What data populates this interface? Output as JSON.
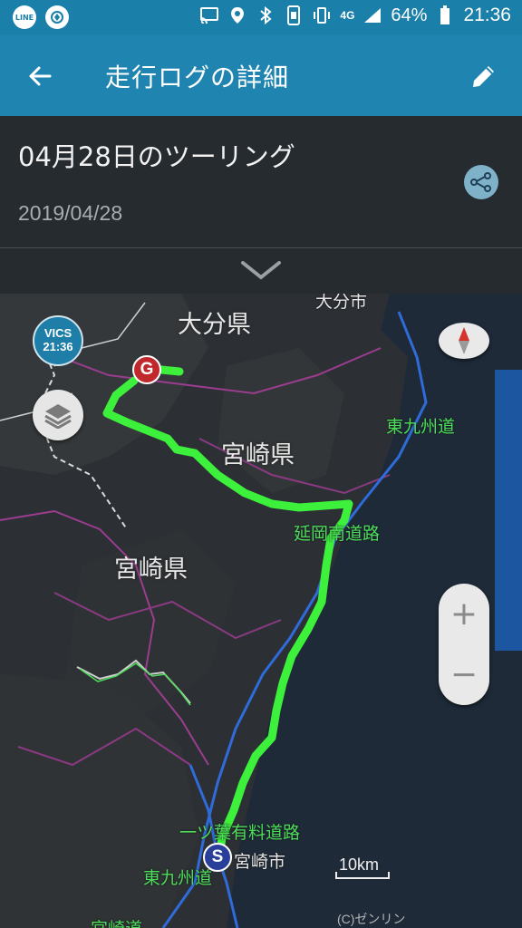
{
  "status_bar": {
    "apps": [
      "LINE",
      "app-circle"
    ],
    "network": "4G",
    "battery_percent": "64%",
    "time": "21:36",
    "icons": [
      "cast-icon",
      "location-icon",
      "bluetooth-icon",
      "phone-icon",
      "vibrate-icon",
      "signal-icon",
      "battery-icon"
    ]
  },
  "app_bar": {
    "title": "走行ログの詳細",
    "back_icon": "arrow-left-icon",
    "edit_icon": "pencil-icon"
  },
  "tour": {
    "title": "04月28日のツーリング",
    "date": "2019/04/28",
    "share_icon": "share-icon",
    "expand_icon": "chevron-down-icon"
  },
  "map": {
    "vics_label": "VICS",
    "vics_time": "21:36",
    "prefectures": [
      "大分県",
      "宮崎県",
      "宮崎県"
    ],
    "roads": [
      "東九州道",
      "延岡南道路",
      "一ツ葉有料道路",
      "東九州道",
      "宮崎道"
    ],
    "cities": [
      "大分市",
      "宮崎市"
    ],
    "start_marker": "S",
    "goal_marker": "G",
    "scale": "10km",
    "copyright": "(C)ゼンリン",
    "zoom_in": "+",
    "zoom_out": "−",
    "colors": {
      "route": "#3cf03c",
      "water": "#1e2a38",
      "land": "#3a3d3f"
    }
  }
}
